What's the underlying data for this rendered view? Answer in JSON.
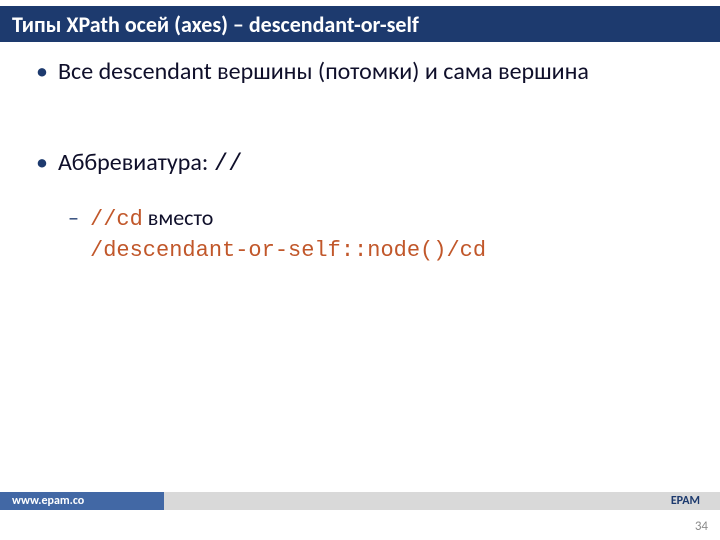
{
  "title": "Типы XPath осей (axes) – descendant-or-self",
  "bullets": {
    "b1": "Все descendant вершины (потомки) и сама вершина",
    "b2_prefix": "Аббревиатура: ",
    "b2_code": "//",
    "sub1_code": "//cd",
    "sub1_mid": " вместо ",
    "sub1_code2": "/descendant-or-self::node()/cd"
  },
  "footer": {
    "left": "www.epam.co",
    "right": "EPAM"
  },
  "page_number": "34"
}
